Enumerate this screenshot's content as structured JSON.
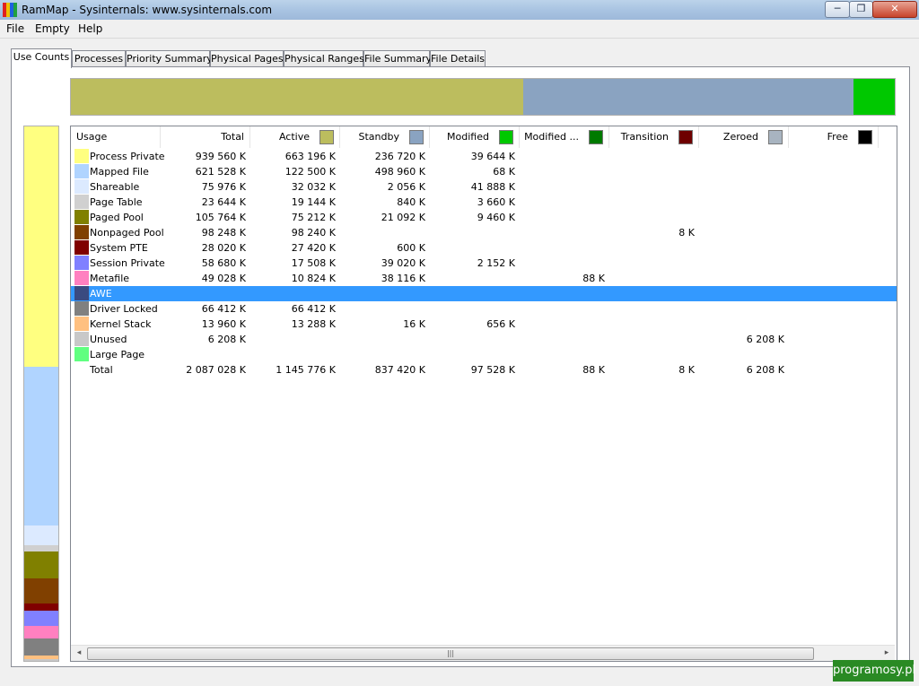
{
  "window": {
    "title": "RamMap - Sysinternals: www.sysinternals.com",
    "min_glyph": "─",
    "max_glyph": "❐",
    "close_glyph": "✕"
  },
  "menu": [
    "File",
    "Empty",
    "Help"
  ],
  "tabs": [
    "Use Counts",
    "Processes",
    "Priority Summary",
    "Physical Pages",
    "Physical Ranges",
    "File Summary",
    "File Details"
  ],
  "active_tab": "Use Counts",
  "columns": [
    {
      "label": "Usage",
      "color": null
    },
    {
      "label": "Total",
      "color": null
    },
    {
      "label": "Active",
      "color": "#bcbd5e"
    },
    {
      "label": "Standby",
      "color": "#8aa3c1"
    },
    {
      "label": "Modified",
      "color": "#00c800"
    },
    {
      "label": "Modified ...",
      "color": "#007a00"
    },
    {
      "label": "Transition",
      "color": "#6e0000"
    },
    {
      "label": "Zeroed",
      "color": "#a8b4c0"
    },
    {
      "label": "Free",
      "color": "#000000"
    }
  ],
  "rows": [
    {
      "label": "Process Private",
      "color": "#ffff80",
      "values": [
        "939 560 K",
        "663 196 K",
        "236 720 K",
        "39 644 K",
        "",
        "",
        "",
        ""
      ]
    },
    {
      "label": "Mapped File",
      "color": "#b0d4ff",
      "values": [
        "621 528 K",
        "122 500 K",
        "498 960 K",
        "68 K",
        "",
        "",
        "",
        ""
      ]
    },
    {
      "label": "Shareable",
      "color": "#dceaff",
      "values": [
        "75 976 K",
        "32 032 K",
        "2 056 K",
        "41 888 K",
        "",
        "",
        "",
        ""
      ]
    },
    {
      "label": "Page Table",
      "color": "#d0d0d0",
      "values": [
        "23 644 K",
        "19 144 K",
        "840 K",
        "3 660 K",
        "",
        "",
        "",
        ""
      ]
    },
    {
      "label": "Paged Pool",
      "color": "#808000",
      "values": [
        "105 764 K",
        "75 212 K",
        "21 092 K",
        "9 460 K",
        "",
        "",
        "",
        ""
      ]
    },
    {
      "label": "Nonpaged Pool",
      "color": "#804000",
      "values": [
        "98 248 K",
        "98 240 K",
        "",
        "",
        "",
        "8 K",
        "",
        ""
      ]
    },
    {
      "label": "System PTE",
      "color": "#800000",
      "values": [
        "28 020 K",
        "27 420 K",
        "600 K",
        "",
        "",
        "",
        "",
        ""
      ]
    },
    {
      "label": "Session Private",
      "color": "#8080ff",
      "values": [
        "58 680 K",
        "17 508 K",
        "39 020 K",
        "2 152 K",
        "",
        "",
        "",
        ""
      ]
    },
    {
      "label": "Metafile",
      "color": "#ff80c0",
      "values": [
        "49 028 K",
        "10 824 K",
        "38 116 K",
        "",
        "88 K",
        "",
        "",
        ""
      ]
    },
    {
      "label": "AWE",
      "color": "#3a4a80",
      "values": [
        "",
        "",
        "",
        "",
        "",
        "",
        "",
        ""
      ]
    },
    {
      "label": "Driver Locked",
      "color": "#808080",
      "values": [
        "66 412 K",
        "66 412 K",
        "",
        "",
        "",
        "",
        "",
        ""
      ]
    },
    {
      "label": "Kernel Stack",
      "color": "#ffc080",
      "values": [
        "13 960 K",
        "13 288 K",
        "16 K",
        "656 K",
        "",
        "",
        "",
        ""
      ]
    },
    {
      "label": "Unused",
      "color": "#c8c8c8",
      "values": [
        "6 208 K",
        "",
        "",
        "",
        "",
        "",
        "6 208 K",
        ""
      ]
    },
    {
      "label": "Large Page",
      "color": "#60ff80",
      "values": [
        "",
        "",
        "",
        "",
        "",
        "",
        "",
        ""
      ]
    },
    {
      "label": "Total",
      "color": null,
      "values": [
        "2 087 028 K",
        "1 145 776 K",
        "837 420 K",
        "97 528 K",
        "88 K",
        "8 K",
        "6 208 K",
        ""
      ]
    }
  ],
  "selected_row": "AWE",
  "scroll_glyphs": {
    "left": "◂",
    "right": "▸",
    "grip": "|||"
  },
  "watermark": "programosy.pl"
}
